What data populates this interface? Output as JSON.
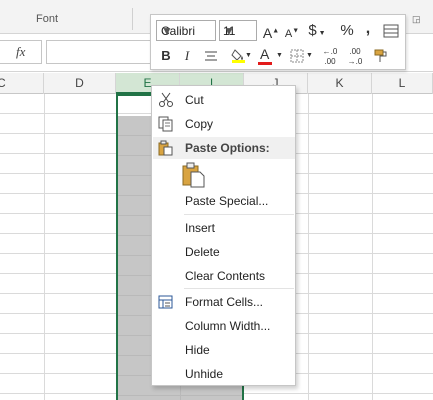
{
  "ribbon": {
    "group_label": "Font"
  },
  "formula_bar": {
    "fx_label": "fx",
    "value": ""
  },
  "columns": [
    {
      "label": "C",
      "selected": false
    },
    {
      "label": "D",
      "selected": false
    },
    {
      "label": "E",
      "selected": true
    },
    {
      "label": "I",
      "selected": true
    },
    {
      "label": "J",
      "selected": false
    },
    {
      "label": "K",
      "selected": false
    },
    {
      "label": "L",
      "selected": false
    }
  ],
  "mini_toolbar": {
    "font_name": "Calibri",
    "font_size": "11",
    "currency_symbol": "$",
    "percent_symbol": "%",
    "comma_symbol": ",",
    "bold": "B",
    "italic": "I",
    "font_color_letter": "A",
    "decrease_decimal": ".00",
    "increase_decimal": ".0",
    "fill_color": "#ffff00",
    "font_color": "#e31b1b"
  },
  "context_menu": {
    "items": [
      {
        "label": "Cut",
        "icon": "scissors-icon"
      },
      {
        "label": "Copy",
        "icon": "copy-icon"
      },
      {
        "label": "Paste Options:",
        "icon": "paste-icon",
        "section": true
      },
      {
        "label": "Paste Special..."
      },
      {
        "label": "Insert"
      },
      {
        "label": "Delete"
      },
      {
        "label": "Clear Contents"
      },
      {
        "label": "Format Cells...",
        "icon": "format-cells-icon"
      },
      {
        "label": "Column Width..."
      },
      {
        "label": "Hide"
      },
      {
        "label": "Unhide"
      }
    ]
  },
  "colors": {
    "excel_green": "#217346",
    "selection_fill": "#c6c6c6"
  }
}
